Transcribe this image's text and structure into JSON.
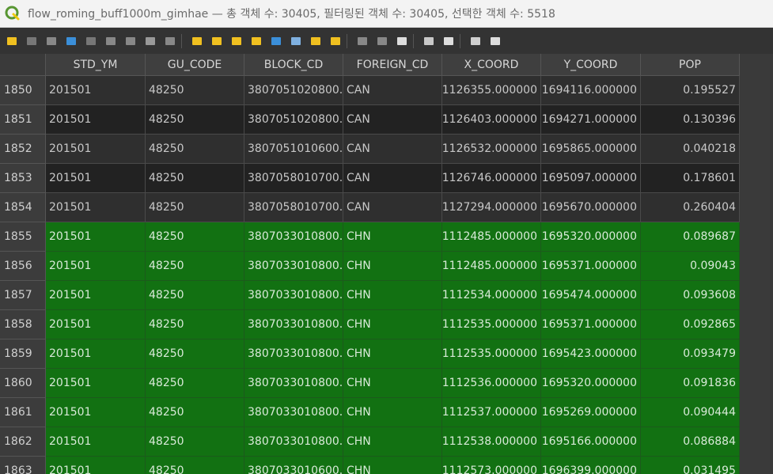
{
  "window": {
    "title": "flow_roming_buff1000m_gimhae — 총 객체 수: 30405, 필터링된 객체 수: 30405, 선택한 객체 수: 5518"
  },
  "toolbar": {
    "icons": [
      "toggle-editing-icon",
      "multi-edit-icon",
      "save-edits-icon",
      "reload-icon",
      "add-feature-icon",
      "delete-feature-icon",
      "cut-icon",
      "copy-icon",
      "paste-icon",
      "select-expression-icon",
      "select-all-icon",
      "invert-selection-icon",
      "deselect-all-icon",
      "filter-select-icon",
      "move-selection-top-icon",
      "pan-to-selected-icon",
      "zoom-to-selected-icon",
      "new-field-icon",
      "delete-field-icon",
      "field-calculator-icon",
      "conditional-formatting-icon",
      "actions-icon",
      "dock-icon",
      "organize-columns-icon"
    ]
  },
  "table": {
    "columns": [
      "STD_YM",
      "GU_CODE",
      "BLOCK_CD",
      "FOREIGN_CD",
      "X_COORD",
      "Y_COORD",
      "POP"
    ],
    "rows": [
      {
        "id": "1850",
        "cells": [
          "201501",
          "48250",
          "3807051020800...",
          "CAN",
          "1126355.000000",
          "1694116.000000",
          "0.195527"
        ],
        "selected": false
      },
      {
        "id": "1851",
        "cells": [
          "201501",
          "48250",
          "3807051020800...",
          "CAN",
          "1126403.000000",
          "1694271.000000",
          "0.130396"
        ],
        "selected": false
      },
      {
        "id": "1852",
        "cells": [
          "201501",
          "48250",
          "3807051010600...",
          "CAN",
          "1126532.000000",
          "1695865.000000",
          "0.040218"
        ],
        "selected": false
      },
      {
        "id": "1853",
        "cells": [
          "201501",
          "48250",
          "3807058010700...",
          "CAN",
          "1126746.000000",
          "1695097.000000",
          "0.178601"
        ],
        "selected": false
      },
      {
        "id": "1854",
        "cells": [
          "201501",
          "48250",
          "3807058010700...",
          "CAN",
          "1127294.000000",
          "1695670.000000",
          "0.260404"
        ],
        "selected": false
      },
      {
        "id": "1855",
        "cells": [
          "201501",
          "48250",
          "3807033010800...",
          "CHN",
          "1112485.000000",
          "1695320.000000",
          "0.089687"
        ],
        "selected": true
      },
      {
        "id": "1856",
        "cells": [
          "201501",
          "48250",
          "3807033010800...",
          "CHN",
          "1112485.000000",
          "1695371.000000",
          "0.09043"
        ],
        "selected": true
      },
      {
        "id": "1857",
        "cells": [
          "201501",
          "48250",
          "3807033010800...",
          "CHN",
          "1112534.000000",
          "1695474.000000",
          "0.093608"
        ],
        "selected": true
      },
      {
        "id": "1858",
        "cells": [
          "201501",
          "48250",
          "3807033010800...",
          "CHN",
          "1112535.000000",
          "1695371.000000",
          "0.092865"
        ],
        "selected": true
      },
      {
        "id": "1859",
        "cells": [
          "201501",
          "48250",
          "3807033010800...",
          "CHN",
          "1112535.000000",
          "1695423.000000",
          "0.093479"
        ],
        "selected": true
      },
      {
        "id": "1860",
        "cells": [
          "201501",
          "48250",
          "3807033010800...",
          "CHN",
          "1112536.000000",
          "1695320.000000",
          "0.091836"
        ],
        "selected": true
      },
      {
        "id": "1861",
        "cells": [
          "201501",
          "48250",
          "3807033010800...",
          "CHN",
          "1112537.000000",
          "1695269.000000",
          "0.090444"
        ],
        "selected": true
      },
      {
        "id": "1862",
        "cells": [
          "201501",
          "48250",
          "3807033010800...",
          "CHN",
          "1112538.000000",
          "1695166.000000",
          "0.086884"
        ],
        "selected": true
      },
      {
        "id": "1863",
        "cells": [
          "201501",
          "48250",
          "3807033010600...",
          "CHN",
          "1112573.000000",
          "1696399.000000",
          "0.031495"
        ],
        "selected": true
      }
    ]
  },
  "colors": {
    "selection": "#127112",
    "row_odd": "#2f2f2f",
    "row_even": "#222222",
    "qgis_green": "#589632",
    "qgis_yellow": "#eec90d"
  }
}
